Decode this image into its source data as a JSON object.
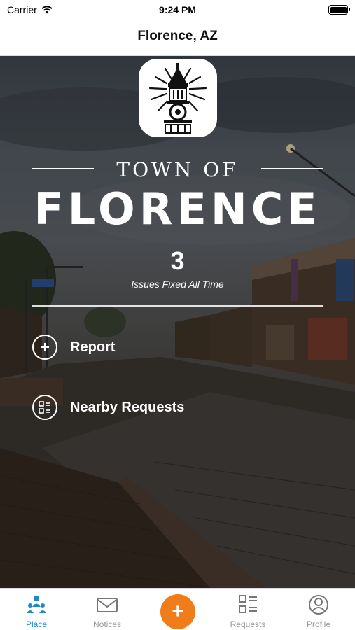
{
  "status_bar": {
    "carrier": "Carrier",
    "time": "9:24 PM"
  },
  "nav": {
    "title": "Florence, AZ"
  },
  "hero": {
    "town_of": "TOWN OF",
    "town_name": "FLORENCE",
    "issues_fixed_count": "3",
    "issues_fixed_label": "Issues Fixed All Time"
  },
  "actions": {
    "report_label": "Report",
    "nearby_label": "Nearby Requests"
  },
  "tab_bar": {
    "fab_symbol": "+",
    "tabs": [
      {
        "label": "Place",
        "icon": "place-icon",
        "active": true
      },
      {
        "label": "Notices",
        "icon": "mail-icon",
        "active": false
      },
      {
        "label": "Requests",
        "icon": "list-icon",
        "active": false
      },
      {
        "label": "Profile",
        "icon": "profile-icon",
        "active": false
      }
    ]
  },
  "colors": {
    "accent": "#1e88c8",
    "fab": "#f07c1a",
    "inactive_tab": "#999999"
  }
}
